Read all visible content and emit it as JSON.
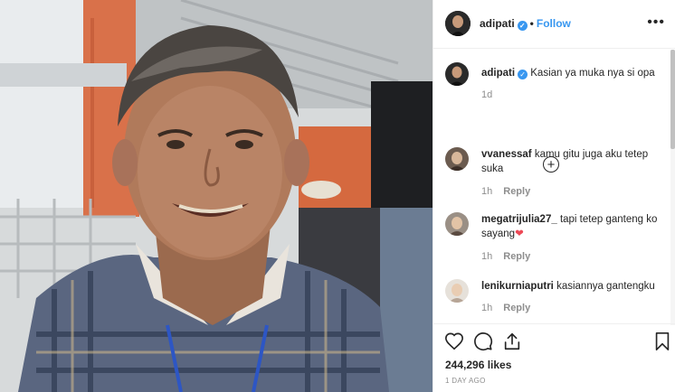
{
  "post": {
    "username": "adipati",
    "follow_label": "Follow",
    "separator": "•",
    "more_label": "•••"
  },
  "caption": {
    "username": "adipati",
    "text": "Kasian ya muka nya si opa",
    "age": "1d",
    "load_more": "+"
  },
  "comments": [
    {
      "username": "vvanessaf",
      "text": "kamu gitu juga aku tetep suka",
      "age": "1h",
      "reply": "Reply"
    },
    {
      "username": "megatrijulia27_",
      "text": "tapi tetep ganteng ko sayang",
      "emoji": "❤",
      "age": "1h",
      "reply": "Reply"
    },
    {
      "username": "lenikurniaputri",
      "text": "kasiannya gantengku",
      "age": "1h",
      "reply": "Reply"
    }
  ],
  "footer": {
    "likes": "244,296 likes",
    "age": "1 DAY AGO"
  },
  "icons": [
    "verified-icon",
    "more-options-icon",
    "add-circle-icon",
    "heart-icon",
    "comment-icon",
    "share-icon",
    "bookmark-icon"
  ],
  "colors": {
    "link": "#3897f0",
    "heart": "#ed4956",
    "muted": "#8e8e8e",
    "text": "#262626"
  }
}
